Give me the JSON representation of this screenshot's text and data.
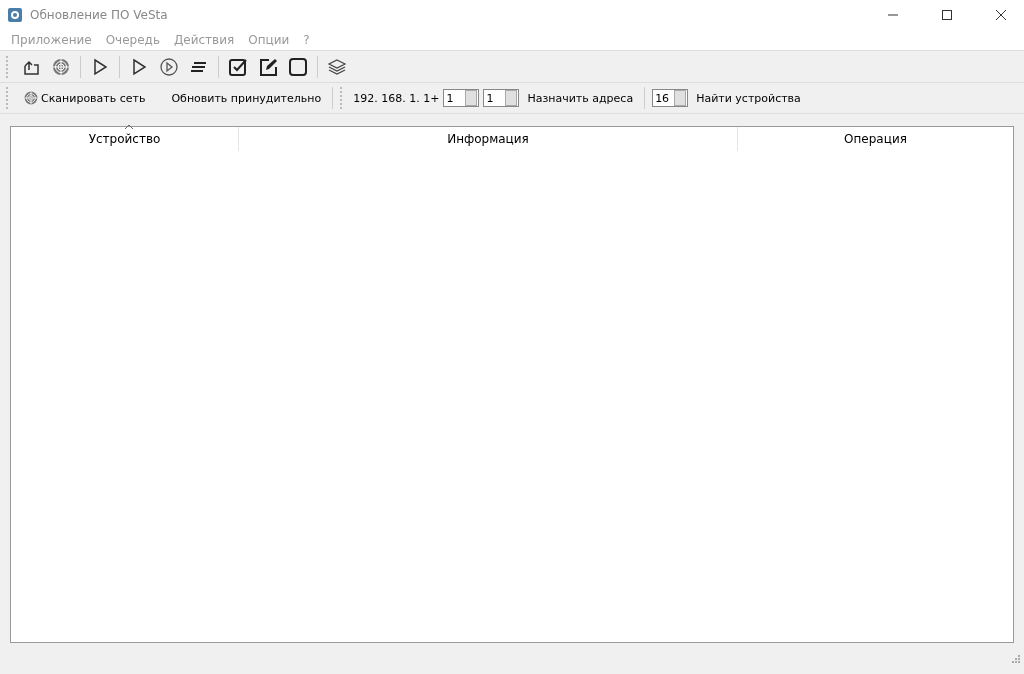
{
  "window": {
    "title": "Обновление ПО VeSta"
  },
  "menu": [
    "Приложение",
    "Очередь",
    "Действия",
    "Опции",
    "?"
  ],
  "toolbar": [
    {
      "kind": "export"
    },
    {
      "kind": "radar"
    },
    {
      "kind": "sep"
    },
    {
      "kind": "play"
    },
    {
      "kind": "sep"
    },
    {
      "kind": "play"
    },
    {
      "kind": "play-circle"
    },
    {
      "kind": "lines"
    },
    {
      "kind": "sep"
    },
    {
      "kind": "check"
    },
    {
      "kind": "edit"
    },
    {
      "kind": "square"
    },
    {
      "kind": "sep"
    },
    {
      "kind": "layers"
    }
  ],
  "network_bar": {
    "scan_button": "Сканировать сеть",
    "force_update_button": "Обновить принудительно",
    "address_prefix": "192. 168. 1. 1+",
    "start_value": "1",
    "count_value": "1",
    "assign_button": "Назначить адреса",
    "find_count": "16",
    "find_button": "Найти устройства"
  },
  "table": {
    "columns": [
      {
        "label": "Устройство",
        "sorted": true
      },
      {
        "label": "Информация",
        "sorted": false
      },
      {
        "label": "Операция",
        "sorted": false
      }
    ]
  }
}
